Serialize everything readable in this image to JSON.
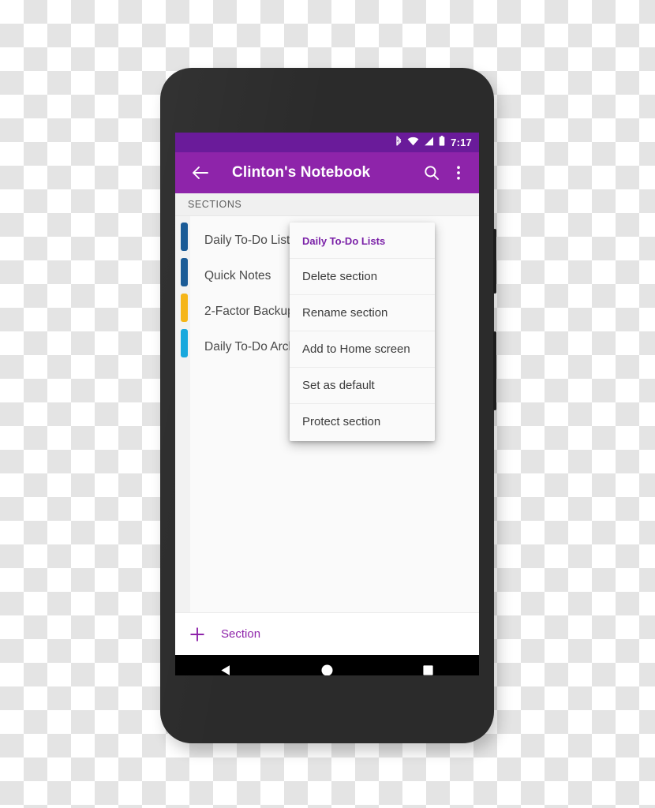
{
  "statusbar": {
    "time": "7:17",
    "icons": [
      "bluetooth-icon",
      "wifi-icon",
      "cell-signal-icon",
      "battery-icon"
    ]
  },
  "toolbar": {
    "back_icon": "back-arrow-icon",
    "title": "Clinton's Notebook",
    "search_icon": "search-icon",
    "overflow_icon": "overflow-menu-icon",
    "background_color": "#8e24aa",
    "statusbar_color": "#6a1b9a"
  },
  "sections_header": {
    "label": "SECTIONS"
  },
  "sections": [
    {
      "name": "Daily To-Do Lists",
      "color": "#1a5b96"
    },
    {
      "name": "Quick Notes",
      "color": "#1a5b96"
    },
    {
      "name": "2-Factor Backup Codes",
      "color": "#f5b517"
    },
    {
      "name": "Daily To-Do Archive",
      "color": "#18a8dd"
    }
  ],
  "context_menu": {
    "title": "Daily To-Do Lists",
    "title_color": "#7b22a8",
    "items": [
      "Delete section",
      "Rename section",
      "Add to Home screen",
      "Set as default",
      "Protect section"
    ]
  },
  "add_bar": {
    "plus_icon": "plus-icon",
    "label": "Section",
    "accent_color": "#8e24aa"
  },
  "navbar": {
    "back_icon": "nav-back-triangle-icon",
    "home_icon": "nav-home-circle-icon",
    "recents_icon": "nav-recents-square-icon"
  }
}
